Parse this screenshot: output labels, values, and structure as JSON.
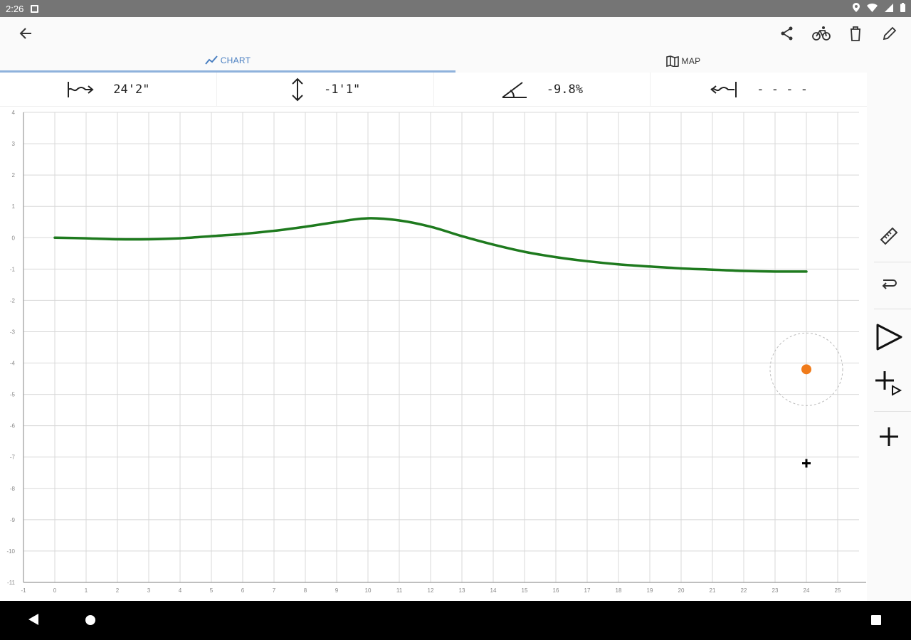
{
  "status_bar": {
    "time": "2:26",
    "icons": [
      "location-icon",
      "wifi-icon",
      "signal-icon",
      "battery-icon"
    ]
  },
  "app_bar": {
    "back_icon": "arrow-left-icon",
    "actions": [
      "share-icon",
      "bicycle-icon",
      "trash-icon",
      "edit-icon"
    ]
  },
  "tabs": [
    {
      "label": "CHART",
      "icon": "chart-line-icon",
      "active": true
    },
    {
      "label": "MAP",
      "icon": "map-icon",
      "active": false
    }
  ],
  "stats": {
    "distance": "24'2\"",
    "elevation": "-1'1\"",
    "grade": "-9.8%",
    "extra": "- - - -"
  },
  "chart_data": {
    "type": "line",
    "x_ticks": [
      "-1",
      "0",
      "1",
      "2",
      "3",
      "4",
      "5",
      "6",
      "7",
      "8",
      "9",
      "10",
      "11",
      "12",
      "13",
      "14",
      "15",
      "16",
      "17",
      "18",
      "19",
      "20",
      "21",
      "22",
      "23",
      "24",
      "25"
    ],
    "y_ticks": [
      "4",
      "3",
      "2",
      "1",
      "0",
      "-1",
      "-2",
      "-3",
      "-4",
      "-5",
      "-6",
      "-7",
      "-8",
      "-9",
      "-10",
      "-11"
    ],
    "xlim": [
      -1,
      25
    ],
    "ylim": [
      -11,
      4
    ],
    "grid": true,
    "series": [
      {
        "color": "#1e7a1e",
        "x": [
          0,
          1,
          2,
          3,
          4,
          5,
          6,
          7,
          8,
          9,
          10,
          11,
          12,
          13,
          14,
          15,
          16,
          17,
          18,
          19,
          20,
          21,
          22,
          23,
          24
        ],
        "y": [
          0,
          -0.02,
          -0.05,
          -0.05,
          -0.02,
          0.05,
          0.12,
          0.22,
          0.35,
          0.5,
          0.62,
          0.55,
          0.35,
          0.05,
          -0.22,
          -0.45,
          -0.62,
          -0.75,
          -0.85,
          -0.92,
          -0.98,
          -1.02,
          -1.06,
          -1.08,
          -1.08
        ]
      }
    ],
    "markers": [
      {
        "name": "position-marker",
        "x": 24,
        "y": -4.2,
        "color": "#f07b1a"
      },
      {
        "name": "target-crosshair",
        "x": 24,
        "y": -7.2,
        "color": "#000000"
      }
    ]
  },
  "sidebar": {
    "buttons": [
      "ruler-icon",
      "loop-back-icon",
      "play-icon",
      "add-play-icon",
      "add-icon"
    ]
  },
  "nav_bar": {
    "buttons": [
      "nav-back-icon",
      "nav-home-icon",
      "nav-recents-icon"
    ]
  },
  "colors": {
    "accent": "#4a7fc1",
    "line": "#1e7a1e",
    "marker": "#f07b1a",
    "grid": "#d8d8d8"
  }
}
